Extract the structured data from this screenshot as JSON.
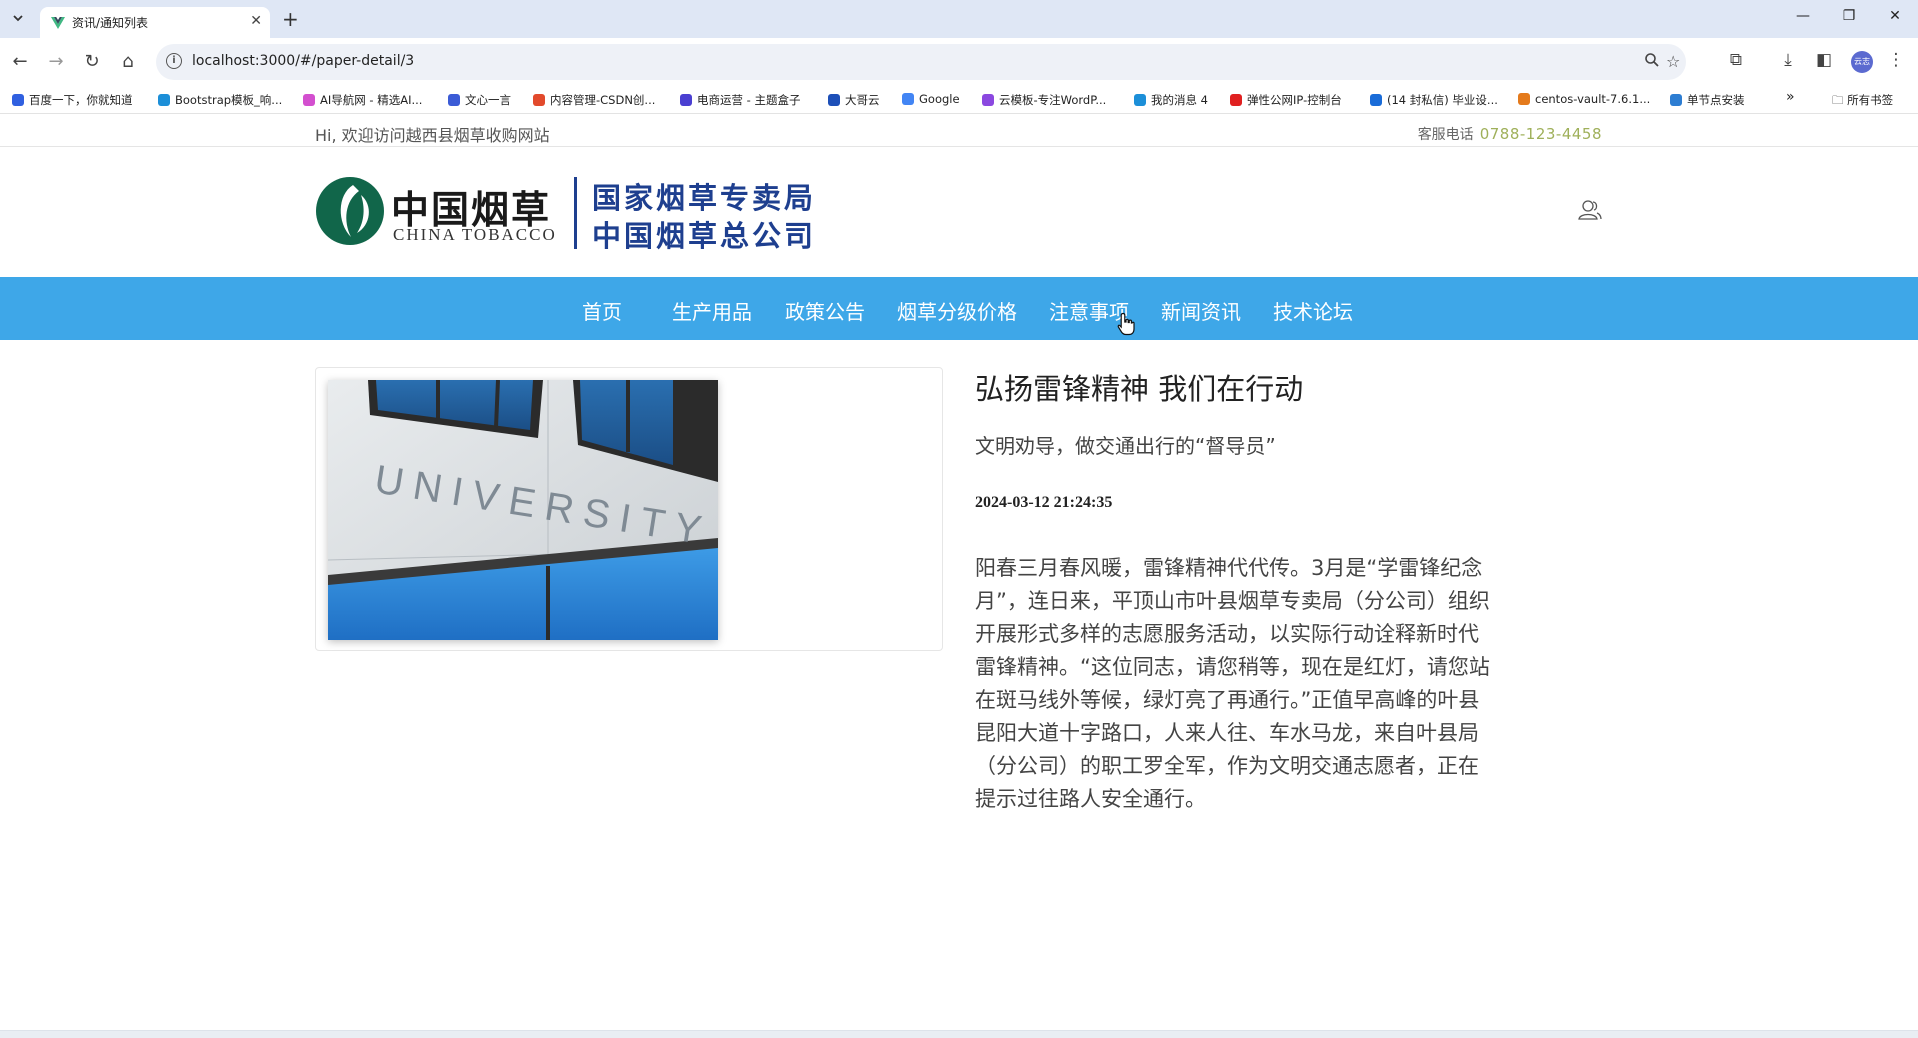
{
  "browser": {
    "tab_title": "资讯/通知列表",
    "tab_list_icon": "chevron-down-icon",
    "new_tab_label": "+",
    "url": "localhost:3000/#/paper-detail/3",
    "bookmarks": [
      {
        "label": "百度一下，你就知道",
        "color": "#3060e0"
      },
      {
        "label": "Bootstrap模板_响...",
        "color": "#1c8fd8"
      },
      {
        "label": "AI导航网 - 精选AI...",
        "color": "#d34fcf"
      },
      {
        "label": "文心一言",
        "color": "#3b5bd6"
      },
      {
        "label": "内容管理-CSDN创...",
        "color": "#e24a2c"
      },
      {
        "label": "电商运营 - 主题盒子",
        "color": "#4a3fd1"
      },
      {
        "label": "大哥云",
        "color": "#1d4fb8"
      },
      {
        "label": "Google",
        "color": "#4285f4"
      },
      {
        "label": "云模板-专注WordP...",
        "color": "#8b48e0"
      },
      {
        "label": "我的消息 4",
        "color": "#1c8fd8"
      },
      {
        "label": "弹性公网IP-控制台",
        "color": "#e02020"
      },
      {
        "label": "(14 封私信) 毕业设...",
        "color": "#1a6cd8"
      },
      {
        "label": "centos-vault-7.6.1...",
        "color": "#e47a1c"
      },
      {
        "label": "单节点安装",
        "color": "#2d7dd2"
      }
    ],
    "bookmarks_overflow": "»",
    "all_bookmarks_label": "所有书签",
    "avatar_text": "云志"
  },
  "topbar": {
    "welcome": "Hi, 欢迎访问越西县烟草收购网站",
    "phone_label": "客服电话",
    "phone_number": "0788-123-4458"
  },
  "logo": {
    "cn": "中国烟草",
    "en": "CHINA TOBACCO",
    "right_line1": "国家烟草专卖局",
    "right_line2": "中国烟草总公司",
    "brand_green": "#11664a",
    "brand_blue": "#1e3f8f"
  },
  "nav": {
    "accent": "#3ea7e8",
    "items": [
      "首页",
      "生产用品",
      "政策公告",
      "烟草分级价格",
      "注意事项",
      "新闻资讯",
      "技术论坛"
    ]
  },
  "article": {
    "image_text": "UNIVERSITY",
    "title": "弘扬雷锋精神 我们在行动",
    "subtitle": "文明劝导，做交通出行的“督导员”",
    "date": "2024-03-12 21:24:35",
    "body": "阳春三月春风暖，雷锋精神代代传。3月是“学雷锋纪念月”，连日来，平顶山市叶县烟草专卖局（分公司）组织开展形式多样的志愿服务活动，以实际行动诠释新时代雷锋精神。“这位同志，请您稍等，现在是红灯，请您站在斑马线外等候，绿灯亮了再通行。”正值早高峰的叶县昆阳大道十字路口，人来人往、车水马龙，来自叶县局（分公司）的职工罗全军，作为文明交通志愿者，正在提示过往路人安全通行。"
  }
}
